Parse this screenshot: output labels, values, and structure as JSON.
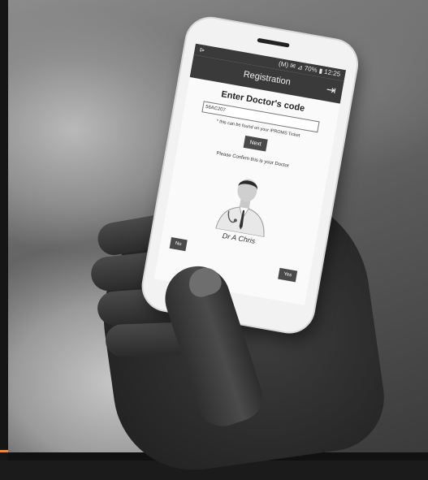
{
  "status_bar": {
    "left_icon": "notification-icon",
    "right_text": "(M) ✉ ⊿ 70% ▮ 12:25"
  },
  "app_bar": {
    "title": "Registration",
    "exit_icon": "logout-icon"
  },
  "form": {
    "heading": "Enter Doctor's code",
    "code_value": "56AC207",
    "hint": "* this can be found on your iPROMS Ticket",
    "next_label": "Next"
  },
  "confirm": {
    "prompt": "Please Confirm this is your Doctor",
    "doctor_name": "Dr A Chris",
    "no_label": "No",
    "yes_label": "Yes"
  },
  "colors": {
    "app_bar": "#3a3a3a",
    "button": "#4a4a4a",
    "accent_strip": "#e5893a"
  }
}
